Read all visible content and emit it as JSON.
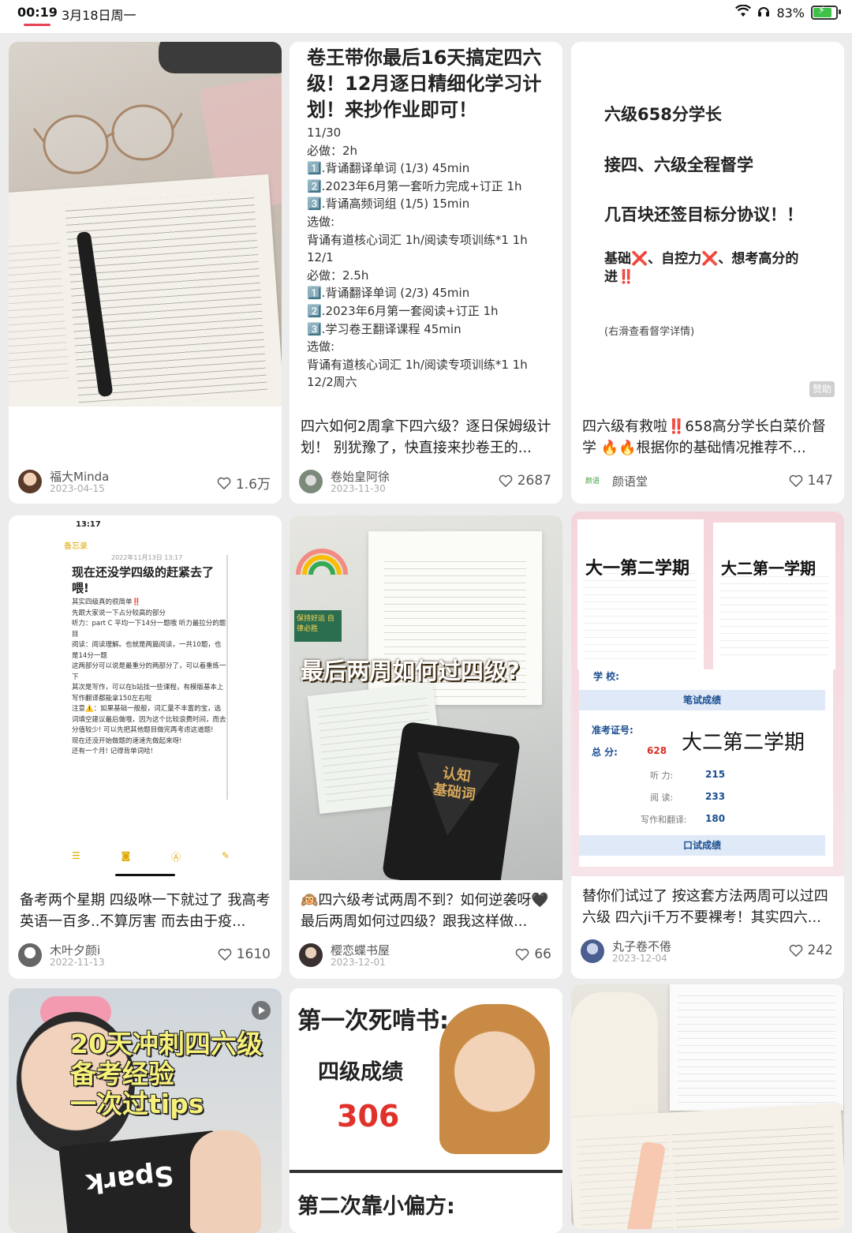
{
  "status_bar": {
    "time": "00:19",
    "date": "3月18日周一",
    "battery": "83%"
  },
  "cards": [
    {
      "title": "",
      "author": "福大Minda",
      "date": "2023-04-15",
      "likes": "1.6万"
    },
    {
      "title": "四六如何2周拿下四六级？逐日保姆级计划！ 别犹豫了，快直接来抄卷王的...",
      "author": "卷始皇阿徐",
      "date": "2023-11-30",
      "likes": "2687",
      "cover": {
        "heading": "卷王带你最后16天搞定四六级！12月逐日精细化学习计划！来抄作业即可！",
        "body": "11/30\n必做：2h\n1️⃣.背诵翻译单词 (1/3) 45min\n2️⃣.2023年6月第一套听力完成+订正 1h\n3️⃣.背诵高频词组 (1/5) 15min\n选做:\n背诵有道核心词汇 1h/阅读专项训练*1 1h\n12/1\n必做：2.5h\n1️⃣.背诵翻译单词 (2/3) 45min\n2️⃣.2023年6月第一套阅读+订正 1h\n3️⃣.学习卷王翻译课程 45min\n选做:\n背诵有道核心词汇 1h/阅读专项训练*1 1h\n12/2周六"
      }
    },
    {
      "title": "四六级有救啦‼️658高分学长白菜价督学 🔥🔥根据你的基础情况推荐不...",
      "author": "颜语堂",
      "date": "",
      "likes": "147",
      "cover": {
        "line1": "六级658分学长",
        "line2": "接四、六级全程督学",
        "line3": "几百块还签目标分协议！！",
        "line4": "基础❌、自控力❌、想考高分的进‼️",
        "hint": "(右滑查看督学详情)",
        "ad": "赞助"
      }
    },
    {
      "title": "备考两个星期 四级咻一下就过了 我高考英语一百多..不算厉害 而去由于疫...",
      "author": "木叶夕颜i",
      "date": "2022-11-13",
      "likes": "1610",
      "cover": {
        "time": "13:17",
        "back": "备忘录",
        "memo_date": "2022年11月13日 13:17",
        "heading": "现在还没学四级的赶紧去了喂!",
        "body": "其实四级真的很简单‼️\n先跟大家说一下占分较高的部分\n听力：part C 平均一下14分一题哦 听力最拉分的题目\n阅读：阅读理解。也就是两篇阅读，一共10题，也是14分一题\n这两部分可以说是最重分的两部分了，可以着重练一下\n其次是写作，可以在b站找一些课程，有模版基本上写作翻译都能拿150左右啦\n注意⚠️：如果基础一般般，词汇量不丰富的宝，选词填空建议最后做哦，因为这个比较浪费时间，而去分值较少! 可以先把其他题目做完再考虑这道题!\n现在还没开始做题的速速先做起来呀!\n还有一个月! 记得背单词哈!"
      }
    },
    {
      "title": "🙉四六级考试两周不到？如何逆袭呀🖤最后两周如何过四级？跟我这样做...",
      "author": "樱恋蝶书屋",
      "date": "2023-12-01",
      "likes": "66",
      "cover": {
        "overlay": "最后两周如何过四级?",
        "tablet_text": "认知\n基础词",
        "sticker": "保持好运 自律必胜"
      }
    },
    {
      "title": "替你们试过了 按这套方法两周可以过四六级 四六ji千万不要裸考！其实四六...",
      "author": "丸子卷不倦",
      "date": "2023-12-04",
      "likes": "242",
      "cover": {
        "label1": "大一第二学期",
        "label2": "大二第一学期",
        "label3": "大二第二学期",
        "written_header": "笔试成绩",
        "oral_header": "口试成绩",
        "school_label": "学    校:",
        "ticket_label": "准考证号:",
        "total_label": "总      分:",
        "total_value": "628",
        "listen_label": "听      力:",
        "listen_value": "215",
        "read_label": "阅      读:",
        "read_value": "233",
        "write_label": "写作和翻译:",
        "write_value": "180"
      }
    },
    {
      "title": "",
      "author": "",
      "date": "",
      "likes": "",
      "cover": {
        "overlay": "20天冲刺四六级\n备考经验\n一次过tips",
        "book": "Spark"
      }
    },
    {
      "title": "",
      "author": "",
      "date": "",
      "likes": "",
      "cover": {
        "line1": "第一次死啃书:",
        "line2": "四级成绩",
        "score": "306",
        "line3": "第二次靠小偏方:"
      }
    },
    {
      "title": "",
      "author": "",
      "date": "",
      "likes": ""
    }
  ],
  "colors": {
    "accent": "#e84256",
    "page_bg": "#ececec",
    "card_bg": "#ffffff"
  }
}
